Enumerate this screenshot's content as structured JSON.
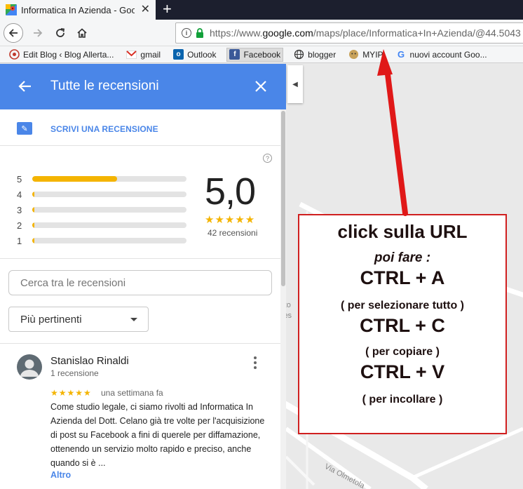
{
  "browser": {
    "tab_title": "Informatica In Azienda - Google Maps",
    "url_prefix": "https://www.",
    "url_host": "google.com",
    "url_rest": "/maps/place/Informatica+In+Azienda/@44.5043",
    "bookmarks": [
      {
        "label": "Edit Blog ‹ Blog Allerta...",
        "icon": "wordpress-icon"
      },
      {
        "label": "gmail",
        "icon": "gmail-icon"
      },
      {
        "label": "Outlook",
        "icon": "outlook-icon"
      },
      {
        "label": "Facebook",
        "icon": "facebook-icon"
      },
      {
        "label": "blogger",
        "icon": "globe-icon"
      },
      {
        "label": "MYIP",
        "icon": "myip-icon"
      },
      {
        "label": "nuovi account Goo...",
        "icon": "google-icon"
      }
    ]
  },
  "panel": {
    "title": "Tutte le recensioni",
    "write_review": "SCRIVI UNA RECENSIONE",
    "help": "?",
    "rating_rows": [
      {
        "label": "5",
        "share": 0.55
      },
      {
        "label": "4",
        "share": 0.0
      },
      {
        "label": "3",
        "share": 0.0
      },
      {
        "label": "2",
        "share": 0.0
      },
      {
        "label": "1",
        "share": 0.0
      }
    ],
    "average": "5,0",
    "average_stars": "★★★★★",
    "review_count": "42 recensioni",
    "search_placeholder": "Cerca tra le recensioni",
    "sort_label": "Più pertinenti"
  },
  "review": {
    "name": "Stanislao Rinaldi",
    "meta": "1 recensione",
    "stars": "★★★★★",
    "time": "una settimana fa",
    "text": "Come studio legale, ci siamo rivolti ad Informatica In Azienda del Dott. Celano già tre volte per l'acquisizione di post su Facebook a fini di querele per diffamazione, ottenendo un servizio molto rapido e preciso, anche quando si è ...",
    "more": "Altro"
  },
  "map": {
    "labels": [
      "rto",
      "ies",
      "Via Olmetola"
    ]
  },
  "annotation": {
    "line1": "click sulla URL",
    "line2": "poi fare :",
    "line3": "CTRL + A",
    "line4": "( per selezionare tutto )",
    "line5": "CTRL + C",
    "line6": "( per copiare )",
    "line7": "CTRL + V",
    "line8": "( per incollare )"
  },
  "colors": {
    "header_blue": "#4a86e8",
    "star_yellow": "#f4b400",
    "annotation_red": "#d01f1f"
  }
}
